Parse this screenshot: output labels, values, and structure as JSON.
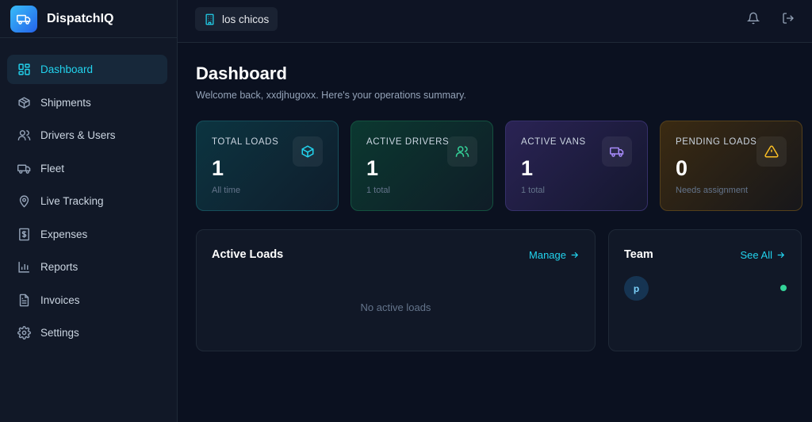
{
  "app": {
    "name": "DispatchIQ",
    "logo_icon": "truck-icon"
  },
  "sidebar": {
    "items": [
      {
        "label": "Dashboard",
        "icon": "grid-icon",
        "active": true
      },
      {
        "label": "Shipments",
        "icon": "package-icon",
        "active": false
      },
      {
        "label": "Drivers & Users",
        "icon": "users-icon",
        "active": false
      },
      {
        "label": "Fleet",
        "icon": "truck-icon",
        "active": false
      },
      {
        "label": "Live Tracking",
        "icon": "map-pin-icon",
        "active": false
      },
      {
        "label": "Expenses",
        "icon": "dollar-receipt-icon",
        "active": false
      },
      {
        "label": "Reports",
        "icon": "bar-chart-icon",
        "active": false
      },
      {
        "label": "Invoices",
        "icon": "file-text-icon",
        "active": false
      },
      {
        "label": "Settings",
        "icon": "gear-icon",
        "active": false
      }
    ]
  },
  "topbar": {
    "organization": "los chicos",
    "org_icon": "building-icon"
  },
  "page": {
    "title": "Dashboard",
    "subtitle": "Welcome back, xxdjhugoxx. Here's your operations summary."
  },
  "stats": [
    {
      "label": "TOTAL LOADS",
      "value": "1",
      "foot": "All time",
      "icon": "cube-icon",
      "color": "#22d3ee"
    },
    {
      "label": "ACTIVE DRIVERS",
      "value": "1",
      "foot": "1 total",
      "icon": "users-icon",
      "color": "#34d399"
    },
    {
      "label": "ACTIVE VANS",
      "value": "1",
      "foot": "1 total",
      "icon": "truck-icon",
      "color": "#a78bfa"
    },
    {
      "label": "PENDING LOADS",
      "value": "0",
      "foot": "Needs assignment",
      "icon": "warning-icon",
      "color": "#fbbf24"
    }
  ],
  "active_loads": {
    "title": "Active Loads",
    "link": "Manage",
    "empty_text": "No active loads"
  },
  "team": {
    "title": "Team",
    "link": "See All",
    "members": [
      {
        "initial": "p",
        "name": "",
        "role": "",
        "online": true
      }
    ]
  },
  "colors": {
    "accent": "#22d3ee",
    "online": "#34d399",
    "background": "#0b1120",
    "panel": "#111827"
  }
}
